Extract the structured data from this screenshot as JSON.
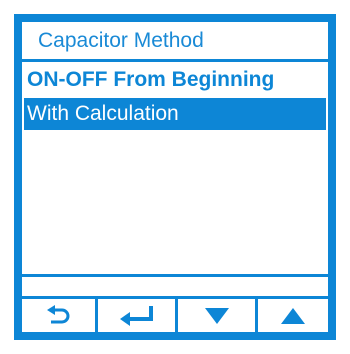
{
  "screen": {
    "title": "Capacitor Method"
  },
  "menu": {
    "items": [
      {
        "label": "ON-OFF From Beginning",
        "selected": false
      },
      {
        "label": "With Calculation",
        "selected": true
      }
    ]
  },
  "softkeys": [
    {
      "icon": "back-arrow-icon"
    },
    {
      "icon": "enter-icon"
    },
    {
      "icon": "down-triangle-icon"
    },
    {
      "icon": "up-triangle-icon"
    }
  ],
  "colors": {
    "accent": "#0d86d6",
    "title_text": "#1a8ad6",
    "background": "#ffffff"
  }
}
